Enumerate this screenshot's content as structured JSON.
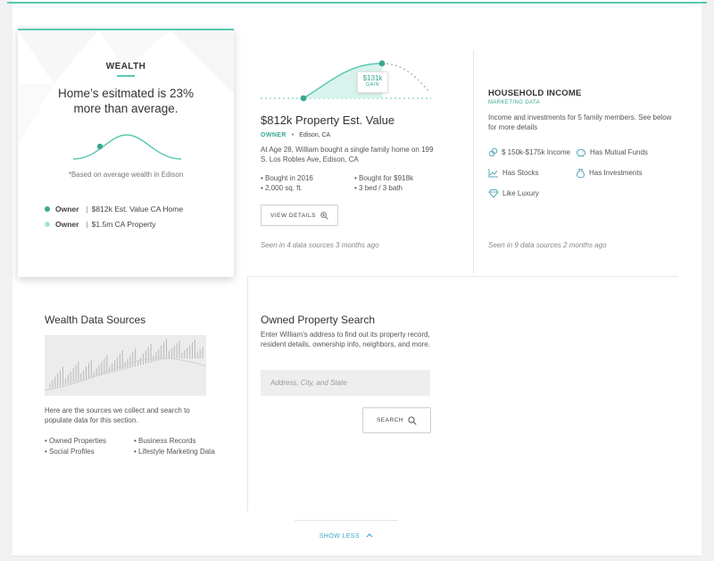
{
  "colors": {
    "accent": "#5bc9b3",
    "accent_dark": "#3aa891",
    "link": "#3aa7c9"
  },
  "wealth": {
    "title": "WEALTH",
    "headline": "Home’s esitmated is 23% more than average.",
    "note": "*Based on average wealth in Edison",
    "legend": [
      {
        "role": "Owner",
        "sep": "|",
        "text": "$812k Est. Value CA Home"
      },
      {
        "role": "Owner",
        "sep": "|",
        "text": "$1.5m CA Property"
      }
    ]
  },
  "property": {
    "gain_value": "$131k",
    "gain_label": "GAIN",
    "title": "$812k Property Est. Value",
    "role": "OWNER",
    "bullet": "•",
    "location": "Edison, CA",
    "description": "At Age 28, William bought a single family home on 199 S. Los Robles Ave, Edison, CA",
    "facts": [
      "• Bought in 2016",
      "• Bought for $918k",
      "• 2,000 sq. ft.",
      "• 3 bed / 3 bath"
    ],
    "button_label": "VIEW DETAILS",
    "seen": "Seen in 4 data sources 3 months ago"
  },
  "household": {
    "title": "HOUSEHOLD INCOME",
    "subtitle": "MARKETING DATA",
    "description": "Income and investments for 5 family members. See below for more details",
    "items": [
      {
        "icon": "link-icon",
        "label": "$ 150k-$175k Income"
      },
      {
        "icon": "piggy-bank-icon",
        "label": "Has Mutual Funds"
      },
      {
        "icon": "stocks-chart-icon",
        "label": "Has Stocks"
      },
      {
        "icon": "money-bag-icon",
        "label": "Has Investments"
      },
      {
        "icon": "diamond-icon",
        "label": "Like Luxury"
      }
    ],
    "seen": "Seen in 9 data sources 2 months ago"
  },
  "sources": {
    "title": "Wealth Data Sources",
    "description": "Here are the sources we collect and search to populate data for this section.",
    "list": [
      "• Owned Properties",
      "• Business Records",
      "• Social Profiles",
      "• Lifestyle Marketing Data"
    ]
  },
  "search": {
    "title": "Owned Property Search",
    "description": "Enter William’s address to find out its property record, resident details, ownership info, neighbors, and more.",
    "placeholder": "Address, City, and State",
    "button_label": "SEARCH"
  },
  "footer": {
    "show_less": "SHOW LESS"
  }
}
